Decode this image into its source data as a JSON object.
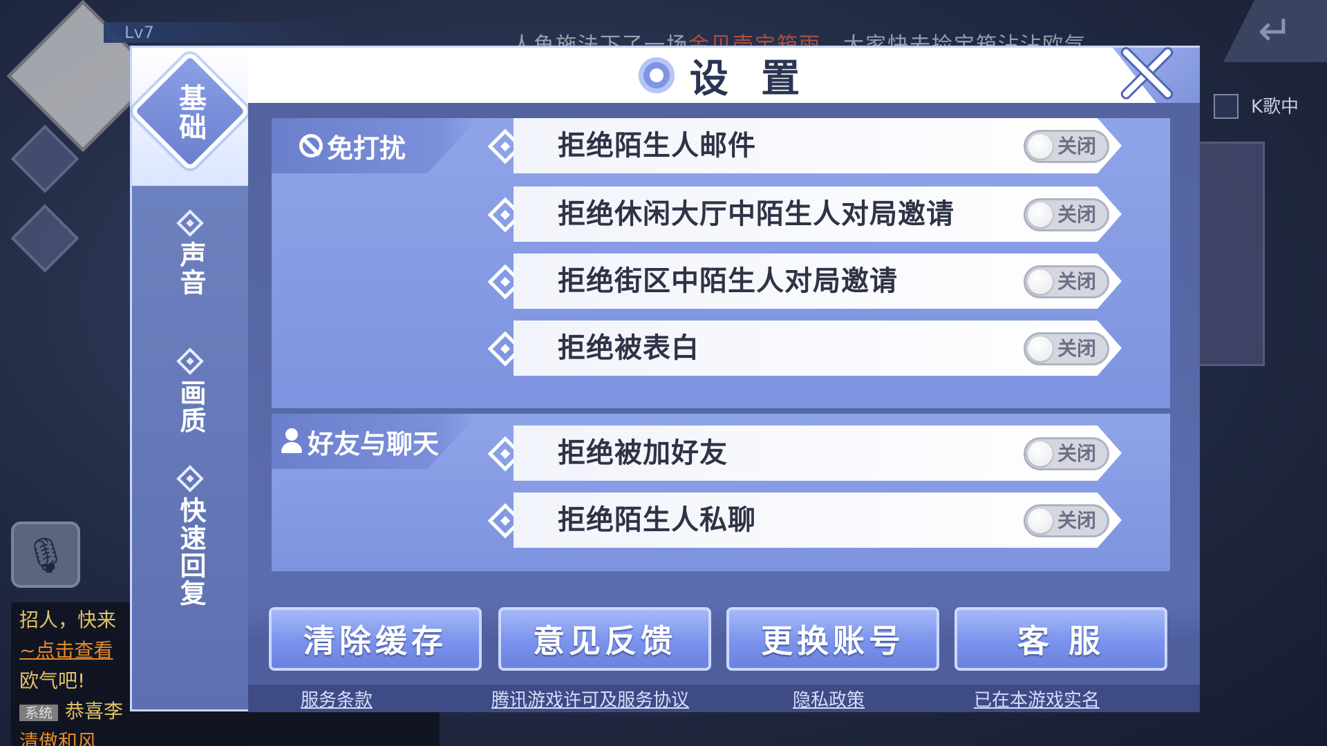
{
  "background": {
    "level": "Lv7",
    "notice_parts": [
      "人鱼施法下了一场",
      "金贝壳宝箱雨",
      "，大家快去捡宝箱沾沾欧气"
    ],
    "karaoke_label": "K歌中",
    "chat": {
      "line1": "招人，快来",
      "line2": "~点击查看",
      "line3": "欧气吧!",
      "system_tag": "系统",
      "line4": "恭喜李",
      "line5": "清傲和风"
    }
  },
  "dialog": {
    "title": "设 置",
    "sidebar": {
      "tabs": [
        {
          "label": "基础",
          "active": true
        },
        {
          "label": "声音",
          "active": false
        },
        {
          "label": "画质",
          "active": false
        },
        {
          "label": "快速回复",
          "active": false
        }
      ]
    },
    "sections": [
      {
        "label": "免打扰",
        "rows": [
          {
            "label": "拒绝陌生人邮件",
            "state": "关闭"
          },
          {
            "label": "拒绝休闲大厅中陌生人对局邀请",
            "state": "关闭"
          },
          {
            "label": "拒绝街区中陌生人对局邀请",
            "state": "关闭"
          },
          {
            "label": "拒绝被表白",
            "state": "关闭"
          }
        ]
      },
      {
        "label": "好友与聊天",
        "rows": [
          {
            "label": "拒绝被加好友",
            "state": "关闭"
          },
          {
            "label": "拒绝陌生人私聊",
            "state": "关闭"
          }
        ]
      }
    ],
    "buttons": {
      "clear_cache": "清除缓存",
      "feedback": "意见反馈",
      "switch_account": "更换账号",
      "support": "客 服"
    },
    "links": {
      "terms": "服务条款",
      "license": "腾讯游戏许可及服务协议",
      "privacy": "隐私政策",
      "realname": "已在本游戏实名"
    }
  }
}
